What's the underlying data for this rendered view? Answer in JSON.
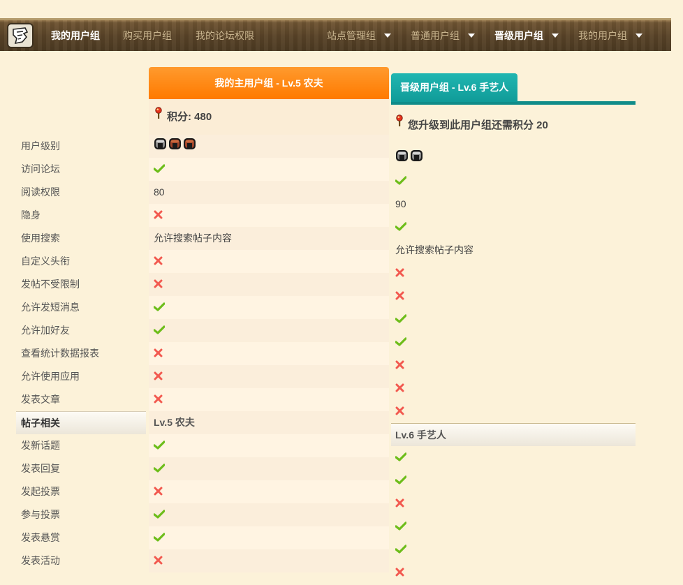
{
  "nav": {
    "items": [
      {
        "label": "我的用户组",
        "strong": true
      },
      {
        "label": "购买用户组",
        "strong": false
      },
      {
        "label": "我的论坛权限",
        "strong": false
      }
    ],
    "dropdowns": [
      {
        "label": "站点管理组",
        "strong": false
      },
      {
        "label": "普通用户组",
        "strong": false
      },
      {
        "label": "晋级用户组",
        "strong": true
      },
      {
        "label": "我的用户组",
        "strong": false
      }
    ]
  },
  "labels": [
    "用户级别",
    "访问论坛",
    "阅读权限",
    "隐身",
    "使用搜索",
    "自定义头衔",
    "发帖不受限制",
    "允许发短消息",
    "允许加好友",
    "查看统计数据报表",
    "允许使用应用",
    "发表文章",
    "帖子相关",
    "发新话题",
    "发表回复",
    "发起投票",
    "参与投票",
    "发表悬赏",
    "发表活动"
  ],
  "col1": {
    "header": "我的主用户组 - Lv.5 农夫",
    "score": "积分: 480",
    "helmets": [
      "silver",
      "brown",
      "brown"
    ],
    "cells": [
      {
        "type": "helmets"
      },
      {
        "type": "check"
      },
      {
        "type": "text",
        "value": "80"
      },
      {
        "type": "cross"
      },
      {
        "type": "text",
        "value": "允许搜索帖子内容"
      },
      {
        "type": "cross"
      },
      {
        "type": "cross"
      },
      {
        "type": "check"
      },
      {
        "type": "check"
      },
      {
        "type": "cross"
      },
      {
        "type": "cross"
      },
      {
        "type": "cross"
      },
      {
        "type": "section",
        "value": "Lv.5 农夫"
      },
      {
        "type": "check"
      },
      {
        "type": "check"
      },
      {
        "type": "cross"
      },
      {
        "type": "check"
      },
      {
        "type": "check"
      },
      {
        "type": "cross"
      }
    ]
  },
  "col2": {
    "header": "晋级用户组 - Lv.6 手艺人",
    "score": "您升级到此用户组还需积分 20",
    "helmets": [
      "silver",
      "silver"
    ],
    "cells": [
      {
        "type": "helmets"
      },
      {
        "type": "check"
      },
      {
        "type": "text",
        "value": "90"
      },
      {
        "type": "check"
      },
      {
        "type": "text",
        "value": "允许搜索帖子内容"
      },
      {
        "type": "cross"
      },
      {
        "type": "cross"
      },
      {
        "type": "check"
      },
      {
        "type": "check"
      },
      {
        "type": "cross"
      },
      {
        "type": "cross"
      },
      {
        "type": "cross"
      },
      {
        "type": "section",
        "value": "Lv.6 手艺人"
      },
      {
        "type": "check"
      },
      {
        "type": "check"
      },
      {
        "type": "cross"
      },
      {
        "type": "check"
      },
      {
        "type": "check"
      },
      {
        "type": "cross"
      }
    ]
  },
  "colors": {
    "check": "#6dbd1a",
    "cross": "#f2594f",
    "orange": "#ff8a10",
    "teal": "#13a6a2"
  }
}
